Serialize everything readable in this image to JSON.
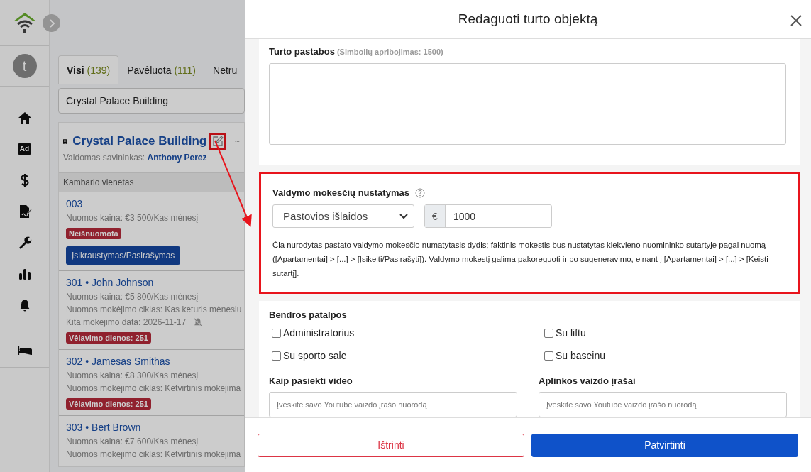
{
  "sidebar": {
    "avatar_initial": "t",
    "ad_badge": "Ad"
  },
  "tabs": [
    {
      "label": "Visi",
      "count": "(139)",
      "selected": true
    },
    {
      "label": "Pavėluota",
      "count": "(111)",
      "selected": false
    },
    {
      "label": "Netru",
      "selected": false
    }
  ],
  "search": {
    "value": "Crystal Palace Building"
  },
  "building": {
    "name": "Crystal Palace Building",
    "owner_label": "Valdomas savininkas:",
    "owner": "Anthony Perez"
  },
  "units_header": "Kambario vienetas",
  "units": [
    {
      "title": "003",
      "lines": [
        {
          "text": "Nuomos kaina: €3 500/Kas mėnesį",
          "kind": "plain"
        }
      ],
      "badge": "Neišnuomota",
      "button": "Įsikraustymas/Pasirašymas"
    },
    {
      "title": "301 • John Johnson",
      "lines": [
        {
          "text": "Nuomos kaina: €5 800/Kas mėnesį",
          "kind": "plain"
        },
        {
          "text": "Nuomos mokėjimo ciklas: Kas keturis mėnesiu",
          "kind": "plain"
        },
        {
          "text": "Kita mokėjimo data:  2026-11-17",
          "kind": "reminder_off"
        }
      ],
      "badge": "Vėlavimo dienos: 251"
    },
    {
      "title": "302 • Jamesas Smithas",
      "lines": [
        {
          "text": "Nuomos kaina: €8 300/Kas mėnesį",
          "kind": "plain"
        },
        {
          "text": "Nuomos mokėjimo ciklas: Ketvirtinis mokėjima",
          "kind": "plain"
        }
      ],
      "badge": "Vėlavimo dienos: 251"
    },
    {
      "title": "303 • Bert Brown",
      "lines": [
        {
          "text": "Nuomos kaina: €7 600/Kas mėnesį",
          "kind": "plain"
        },
        {
          "text": "Nuomos mokėjimo ciklas: Ketvirtinis mokėjima",
          "kind": "plain"
        }
      ]
    }
  ],
  "modal": {
    "title": "Redaguoti turto objektą",
    "notes": {
      "label": "Turto pastabos",
      "hint": "(Simbolių apribojimas: 1500)"
    },
    "fee": {
      "label": "Valdymo mokesčių nustatymas",
      "type_value": "Pastovios išlaidos",
      "currency": "€",
      "amount": "1000",
      "description": "Čia nurodytas pastato valdymo mokesčio numatytasis dydis; faktinis mokestis bus nustatytas kiekvieno nuomininko sutartyje pagal nuomą ([Apartamentai] > [...] > [Įsikelti/Pasirašyti]). Valdymo mokestį galima pakoreguoti ir po sugeneravimo, einant į [Apartamentai] > [...] > [Keisti sutartį]."
    },
    "common_areas": {
      "label": "Bendros patalpos",
      "options": [
        {
          "label": "Administratorius",
          "checked": false
        },
        {
          "label": "Su liftu",
          "checked": false
        },
        {
          "label": "Su sporto sale",
          "checked": false
        },
        {
          "label": "Su baseinu",
          "checked": false
        }
      ]
    },
    "videos": [
      {
        "label": "Kaip pasiekti video",
        "placeholder": "Įveskite savo Youtube vaizdo įrašo nuorodą"
      },
      {
        "label": "Aplinkos vaizdo įrašai",
        "placeholder": "Įveskite savo Youtube vaizdo įrašo nuorodą"
      }
    ],
    "buttons": [
      {
        "label": "Ištrinti",
        "kind": "danger"
      },
      {
        "label": "Patvirtinti",
        "kind": "primary"
      }
    ]
  }
}
